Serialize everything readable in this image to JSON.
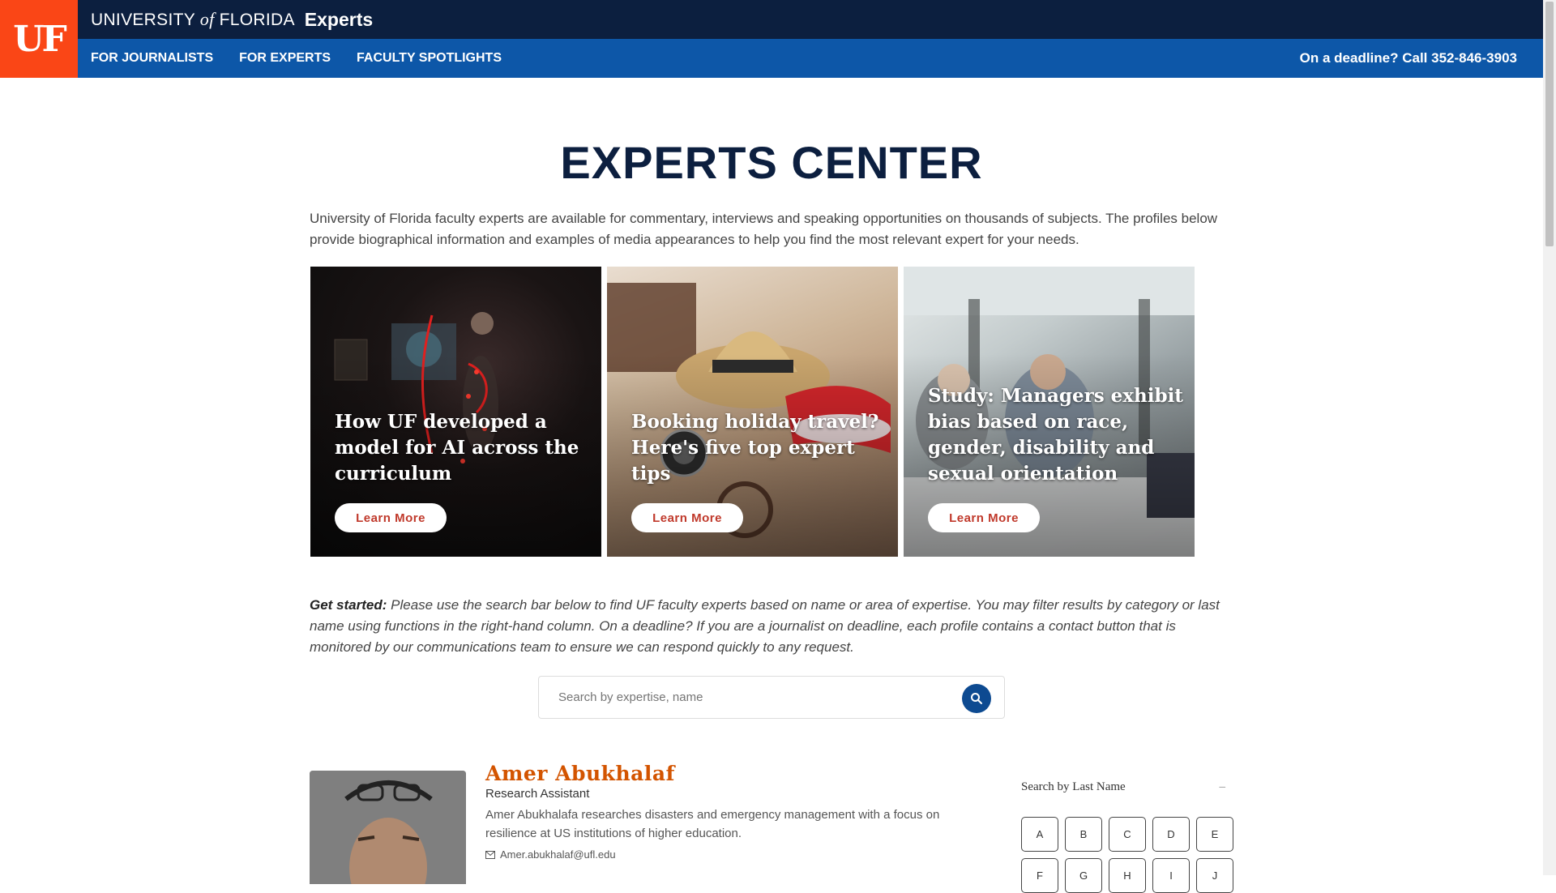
{
  "header": {
    "logo_text": "UF",
    "university_prefix": "UNIVERSITY",
    "university_of": "of",
    "university_suffix": "FLORIDA",
    "site_name": "Experts",
    "nav": [
      "FOR JOURNALISTS",
      "FOR EXPERTS",
      "FACULTY SPOTLIGHTS"
    ],
    "deadline": "On a deadline? Call 352-846-3903"
  },
  "main": {
    "title": "EXPERTS CENTER",
    "intro": "University of Florida faculty experts are available for commentary, interviews and speaking opportunities on thousands of subjects. The profiles below provide biographical information and examples of media appearances to help you find the most relevant expert for your needs.",
    "cards": [
      {
        "title": "How UF developed a model for AI across the curriculum",
        "button": "Learn More"
      },
      {
        "title": "Booking holiday travel? Here's five top expert tips",
        "button": "Learn More"
      },
      {
        "title": "Study: Managers exhibit bias based on race, gender, disability and sexual orientation",
        "button": "Learn More"
      }
    ],
    "get_started_label": "Get started:",
    "get_started_text": " Please use the search bar below to find UF faculty experts based on name or area of expertise. You may filter results by category or last name using functions in the right-hand column. On a deadline? If you are a journalist on deadline, each profile contains a contact button that is monitored by our communications team to ensure we can respond quickly to any request.",
    "search": {
      "placeholder": "Search by expertise, name",
      "icon": "search-icon"
    }
  },
  "expert": {
    "name": "Amer Abukhalaf",
    "role": "Research Assistant",
    "description": "Amer Abukhalafa researches disasters and emergency management with a focus on resilience at US institutions of higher education.",
    "email": "Amer.abukhalaf@ufl.edu"
  },
  "sidebar": {
    "lastname_heading": "Search by Last Name",
    "collapse_symbol": "–",
    "letters": [
      "A",
      "B",
      "C",
      "D",
      "E",
      "F",
      "G",
      "H",
      "I",
      "J"
    ]
  },
  "colors": {
    "uf_orange": "#fa4616",
    "navy": "#0c1f3f",
    "nav_blue": "#0d57a8",
    "expert_name": "#d35400"
  }
}
